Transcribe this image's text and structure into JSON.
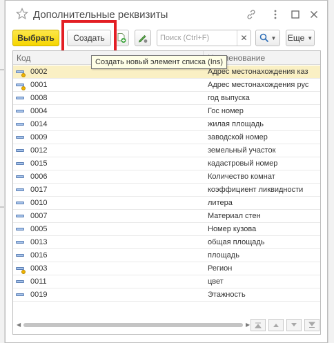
{
  "window": {
    "title": "Дополнительные реквизиты"
  },
  "toolbar": {
    "choose_label": "Выбрать",
    "create_label": "Создать",
    "search_placeholder": "Поиск (Ctrl+F)",
    "search_value": "",
    "more_label": "Еще"
  },
  "tooltip": {
    "text": "Создать новый элемент списка (Ins)"
  },
  "table": {
    "columns": [
      "Код",
      "Наименование"
    ],
    "rows": [
      {
        "code": "0002",
        "name": "Адрес местонахождения каз",
        "selected": true,
        "marked": true
      },
      {
        "code": "0001",
        "name": "Адрес местонахождения рус",
        "selected": false,
        "marked": true
      },
      {
        "code": "0008",
        "name": "год выпуска",
        "selected": false,
        "marked": false
      },
      {
        "code": "0004",
        "name": "Гос номер",
        "selected": false,
        "marked": false
      },
      {
        "code": "0014",
        "name": "жилая площадь",
        "selected": false,
        "marked": false
      },
      {
        "code": "0009",
        "name": "заводской номер",
        "selected": false,
        "marked": false
      },
      {
        "code": "0012",
        "name": "земельный участок",
        "selected": false,
        "marked": false
      },
      {
        "code": "0015",
        "name": "кадастровый номер",
        "selected": false,
        "marked": false
      },
      {
        "code": "0006",
        "name": "Количество комнат",
        "selected": false,
        "marked": false
      },
      {
        "code": "0017",
        "name": "коэффициент ликвидности",
        "selected": false,
        "marked": false
      },
      {
        "code": "0010",
        "name": "литера",
        "selected": false,
        "marked": false
      },
      {
        "code": "0007",
        "name": "Материал стен",
        "selected": false,
        "marked": false
      },
      {
        "code": "0005",
        "name": "Номер кузова",
        "selected": false,
        "marked": false
      },
      {
        "code": "0013",
        "name": "общая площадь",
        "selected": false,
        "marked": false
      },
      {
        "code": "0016",
        "name": "площадь",
        "selected": false,
        "marked": false
      },
      {
        "code": "0003",
        "name": "Регион",
        "selected": false,
        "marked": true
      },
      {
        "code": "0011",
        "name": "цвет",
        "selected": false,
        "marked": false
      },
      {
        "code": "0019",
        "name": "Этажность",
        "selected": false,
        "marked": false
      }
    ]
  },
  "icons": {
    "title_star": "star-icon",
    "link": "link-icon",
    "more_vertical": "more-vertical-icon",
    "maximize": "maximize-icon",
    "close": "close-icon",
    "create_group": "add-folder-icon",
    "edit": "edit-pencil-icon",
    "search_button": "search-icon"
  },
  "colors": {
    "primary_button": "#f6d600",
    "selected_row": "#faf0c4",
    "highlight_box": "#e31e24",
    "tooltip_bg": "#fefee6"
  }
}
